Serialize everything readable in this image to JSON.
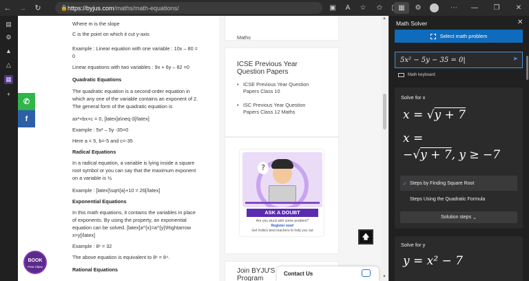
{
  "browser": {
    "url_host": "https://byjus.com",
    "url_path": "/maths/math-equations/"
  },
  "article": {
    "lines": [
      {
        "text": "Where m is the slope",
        "heading": false
      },
      {
        "text": "C is the point on which it cut y-axis",
        "heading": false
      },
      {
        "text": "Example : Linear equation with one variable : 10x – 80 =",
        "heading": false
      },
      {
        "text": "0",
        "heading": false
      },
      {
        "text": "Linear equations with two variables : 9x + 6y – 82 =0",
        "heading": false
      },
      {
        "text": "Quadratic Equations",
        "heading": true
      },
      {
        "text": "The quadratic equation is a second-order equation in",
        "heading": false
      },
      {
        "text": "which any one of the variable contains an exponent of 2.",
        "heading": false
      },
      {
        "text": "The general form of the quadratic equation is",
        "heading": false
      },
      {
        "text": "ax²+bx+c = 0, [latex]a\\neq 0[/latex]",
        "heading": false
      },
      {
        "text": "Example : 5x² – 5y -35=0",
        "heading": false
      },
      {
        "text": "Here a = 5, b=-5 and c=-35",
        "heading": false
      },
      {
        "text": "Radical Equations",
        "heading": true
      },
      {
        "text": "In a radical equation, a variable is lying inside a square",
        "heading": false
      },
      {
        "text": "root symbol or you can say that the maximum exponent",
        "heading": false
      },
      {
        "text": "on a variable is ½",
        "heading": false
      },
      {
        "text": "Example : [latex]\\sqrt{a}+10 = 26[/latex]",
        "heading": false
      },
      {
        "text": "Exponential Equations",
        "heading": true
      },
      {
        "text": "In this math equations, it contains the variables in place",
        "heading": false
      },
      {
        "text": "of exponents. By using the property, an exponential",
        "heading": false
      },
      {
        "text": "equation can be solved. [latex]a^{x}=a^{y}\\Rightarrow",
        "heading": false
      },
      {
        "text": "x=y[/latex]",
        "heading": false
      },
      {
        "text": "Example : 8ˣ = 32",
        "heading": false
      },
      {
        "text": "The above equation is equivalent to 8ˣ = 8⁴.",
        "heading": false
      },
      {
        "text": "Rational Equations",
        "heading": true
      }
    ],
    "book_label": "BOOK",
    "book_sub": "Free Class"
  },
  "sidebar_cards": {
    "top_item": "Maths",
    "icse_title_1": "ICSE Previous Year",
    "icse_title_2": "Question Papers",
    "icse_items": [
      {
        "line1": "ICSE Previous Year Question",
        "line2": "Papers Class 10"
      },
      {
        "line1": "ISC Previous Year Question",
        "line2": "Papers Class 12 Maths"
      }
    ],
    "doubt_button": "ASK A DOUBT",
    "doubt_sub1": "Are you stuck with some problem?",
    "doubt_sub2": "Register now!",
    "doubt_sub3": "Get India's best teachers to help you out",
    "join_title_1": "Join BYJU'S",
    "join_title_2": "Program",
    "contact_label": "Contact Us"
  },
  "solver": {
    "title": "Math Solver",
    "select_button": "Select math problem",
    "input_value": "5x² − 5y − 35 = 0",
    "keyboard_label": "Math keyboard",
    "solve_x_title": "Solve for x",
    "solve_x_1": "x = √",
    "solve_x_1_rad": "y + 7",
    "solve_x_2a": "x =",
    "solve_x_2b": "−√",
    "solve_x_2b_rad": "y + 7",
    "solve_x_2c": ", y ≥ −7",
    "method_1": "Steps by Finding Square Root",
    "method_2": "Steps Using the Quadratic Formula",
    "steps_button": "Solution steps",
    "solve_y_title": "Solve for y",
    "solve_y_1": "y = x² − 7"
  },
  "colors": {
    "accent": "#0f6cbd",
    "whatsapp": "#2fb54a",
    "facebook": "#2c5fa8",
    "ask_doubt": "#5a2bb0"
  }
}
